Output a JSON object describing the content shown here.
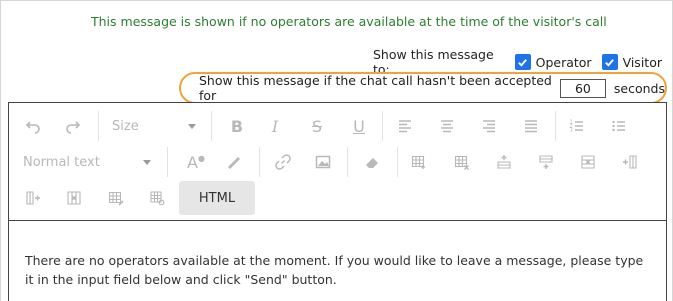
{
  "notice_text": "This message is shown if no operators are available at the time of the visitor's call",
  "show_to": {
    "label": "Show this message to:",
    "operator_label": "Operator",
    "operator_checked": true,
    "visitor_label": "Visitor",
    "visitor_checked": true
  },
  "timeout": {
    "label": "Show this message if the chat call hasn't been accepted for",
    "value": "60",
    "unit": "seconds"
  },
  "toolbar": {
    "size_label": "Size",
    "format_label": "Normal text",
    "html_label": "HTML",
    "icons": [
      "undo-icon",
      "redo-icon",
      "bold-icon",
      "italic-icon",
      "strikethrough-icon",
      "underline-icon",
      "align-left-icon",
      "align-center-icon",
      "align-right-icon",
      "align-justify-icon",
      "ordered-list-icon",
      "unordered-list-icon",
      "font-color-icon",
      "highlight-icon",
      "link-icon",
      "image-icon",
      "eraser-icon",
      "table-icons"
    ]
  },
  "editor_text": "There are no operators available at the moment. If you would like to leave a message, please type it in the input field below and click \"Send\" button.",
  "colors": {
    "accent": "#1e73e8",
    "highlight_border": "#f0a23b",
    "notice": "#2e7d32"
  }
}
